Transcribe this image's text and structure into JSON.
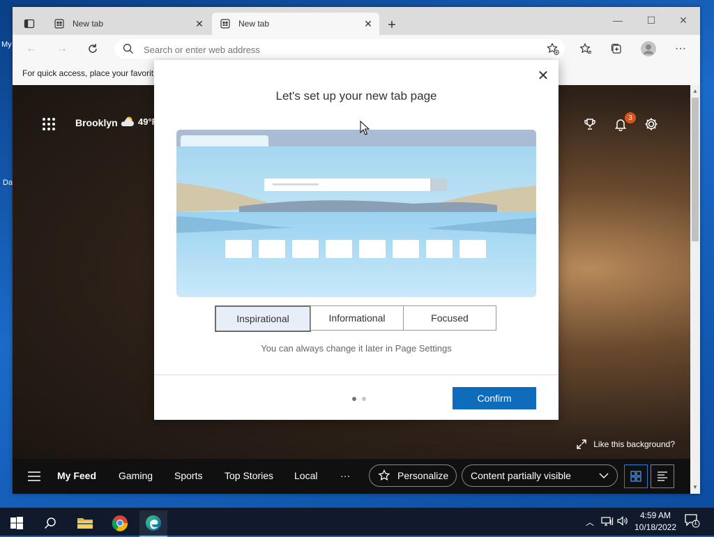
{
  "desktop": {
    "label_1": "My",
    "label_2": "Da"
  },
  "tabs": [
    {
      "title": "New tab",
      "active": false
    },
    {
      "title": "New tab",
      "active": true
    }
  ],
  "address": {
    "placeholder": "Search or enter web address"
  },
  "favorites_bar": {
    "text": "For quick access, place your favorit"
  },
  "newtab": {
    "city": "Brooklyn",
    "temperature": "49°F",
    "notifications_count": "3",
    "like_background": "Like this background?",
    "feed": {
      "items": [
        "My Feed",
        "Gaming",
        "Sports",
        "Top Stories",
        "Local"
      ],
      "more": "···",
      "personalize": "Personalize",
      "content_visibility": "Content partially visible"
    }
  },
  "dialog": {
    "title": "Let's set up your new tab page",
    "options": [
      "Inspirational",
      "Informational",
      "Focused"
    ],
    "selected_option": "Inspirational",
    "note": "You can always change it later in Page Settings",
    "confirm": "Confirm",
    "page_indicator": {
      "current": 1,
      "total": 2
    }
  },
  "taskbar": {
    "time": "4:59 AM",
    "date": "10/18/2022",
    "notification_count": "1"
  },
  "colors": {
    "accent": "#0f6cbd",
    "badge": "#d9541c",
    "taskbar": "#101a2c"
  }
}
